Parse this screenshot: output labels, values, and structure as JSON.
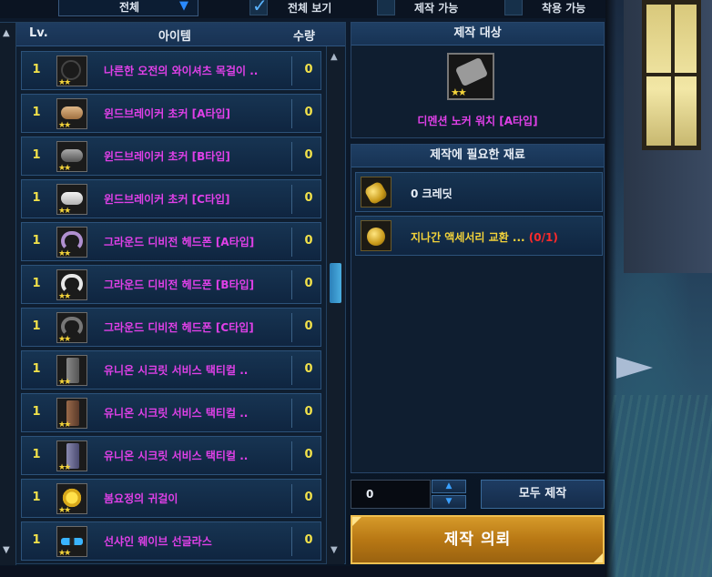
{
  "filter": {
    "category_label": "전체",
    "options": [
      {
        "label": "전체 보기",
        "checked": true
      },
      {
        "label": "제작 가능",
        "checked": false
      },
      {
        "label": "착용 가능",
        "checked": false
      }
    ]
  },
  "list": {
    "headers": {
      "level": "Lv.",
      "item": "아이템",
      "quantity": "수량"
    },
    "rows": [
      {
        "level": "1",
        "name": "나른한 오전의 와이셔츠 목걸이 ..",
        "quantity": "0",
        "icon": "shirt-necklace-icon"
      },
      {
        "level": "1",
        "name": "윈드브레이커 초커 [A타입]",
        "quantity": "0",
        "icon": "choker-tan-icon"
      },
      {
        "level": "1",
        "name": "윈드브레이커 초커 [B타입]",
        "quantity": "0",
        "icon": "choker-gray-icon"
      },
      {
        "level": "1",
        "name": "윈드브레이커 초커 [C타입]",
        "quantity": "0",
        "icon": "choker-white-icon"
      },
      {
        "level": "1",
        "name": "그라운드 디비전 헤드폰 [A타입]",
        "quantity": "0",
        "icon": "headphone-purple-icon"
      },
      {
        "level": "1",
        "name": "그라운드 디비전 헤드폰 [B타입]",
        "quantity": "0",
        "icon": "headphone-white-icon"
      },
      {
        "level": "1",
        "name": "그라운드 디비전 헤드폰 [C타입]",
        "quantity": "0",
        "icon": "headphone-black-icon"
      },
      {
        "level": "1",
        "name": "유니온 시크릿 서비스 택티컬 ..",
        "quantity": "0",
        "icon": "tactical-gray-icon"
      },
      {
        "level": "1",
        "name": "유니온 시크릿 서비스 택티컬 ..",
        "quantity": "0",
        "icon": "tactical-brown-icon"
      },
      {
        "level": "1",
        "name": "유니온 시크릿 서비스 택티컬 ..",
        "quantity": "0",
        "icon": "tactical-blue-icon"
      },
      {
        "level": "1",
        "name": "봄요정의 귀걸이",
        "quantity": "0",
        "icon": "flower-earring-icon"
      },
      {
        "level": "1",
        "name": "선샤인 웨이브 선글라스",
        "quantity": "0",
        "icon": "sunglasses-icon"
      }
    ]
  },
  "target": {
    "title": "제작 대상",
    "item_name": "디멘션 노커 워치 [A타입]",
    "icon": "watch-icon"
  },
  "materials": {
    "title": "제작에 필요한 재료",
    "items": [
      {
        "label": "0 크레딧",
        "count": "",
        "icon": "credit-coin-icon"
      },
      {
        "label": "지나간 액세서리 교환 ... ",
        "count": "(0/1)",
        "icon": "exchange-coin-icon"
      }
    ]
  },
  "controls": {
    "quantity_value": "0",
    "craft_all_label": "모두 제작",
    "request_label": "제작 의뢰"
  }
}
